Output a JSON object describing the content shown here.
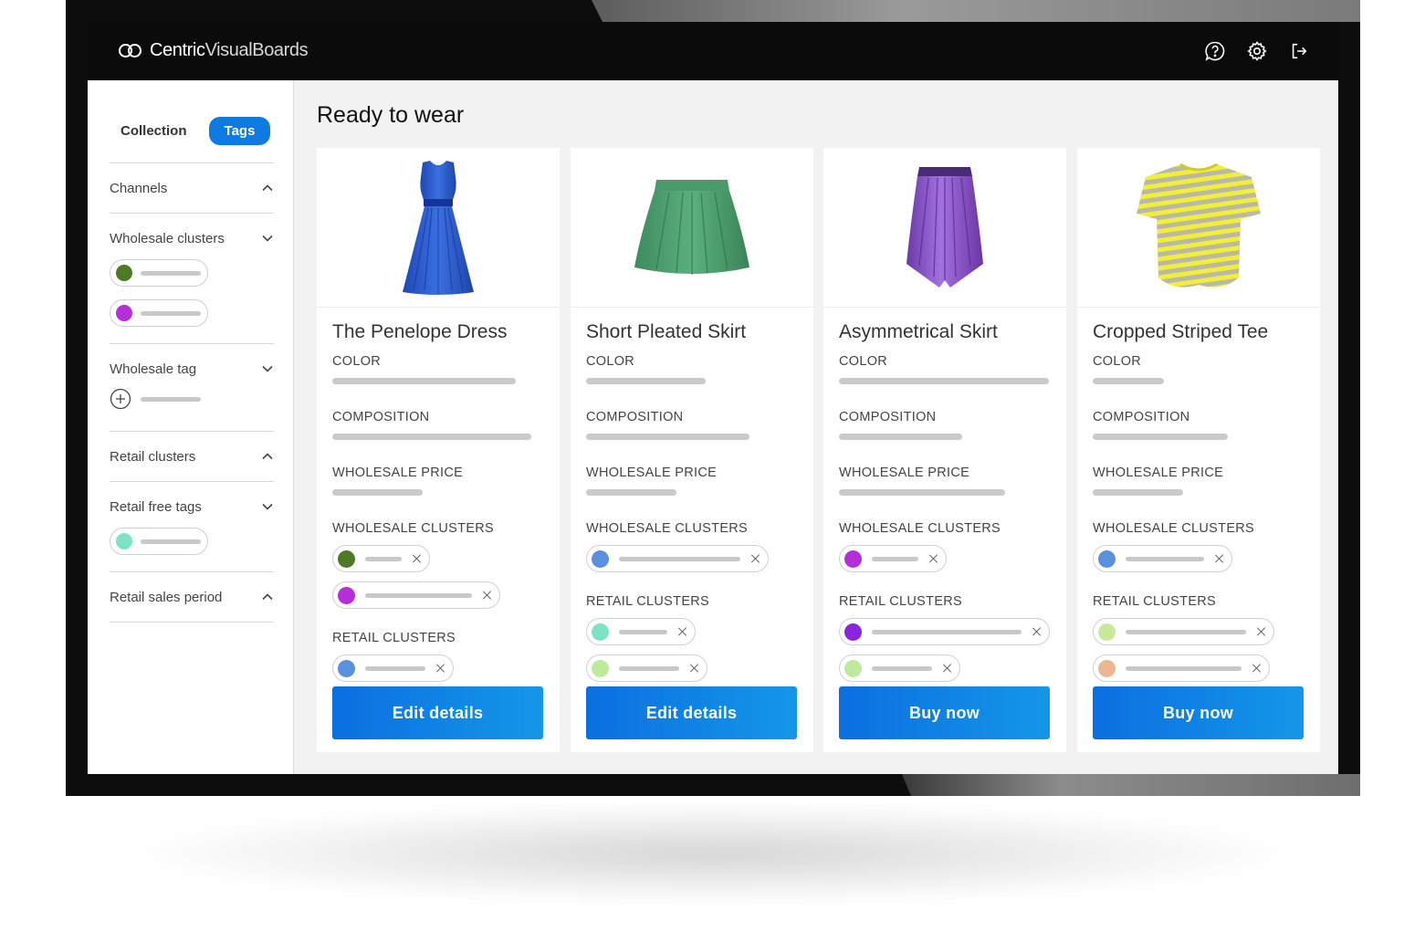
{
  "brand": {
    "name_part1": "Centric",
    "name_part2": "VisualBoards"
  },
  "topbar": {
    "icons": [
      "help-icon",
      "settings-icon",
      "logout-icon"
    ]
  },
  "sidebar": {
    "toggle": {
      "collection": "Collection",
      "tags": "Tags",
      "active": "Tags"
    },
    "sections": [
      {
        "label": "Channels",
        "chevron": "up"
      },
      {
        "label": "Wholesale clusters",
        "chevron": "down",
        "chip_colors": [
          "#4e7a26",
          "#b42fd9"
        ]
      },
      {
        "label": "Wholesale tag",
        "chevron": "down",
        "add": true
      },
      {
        "label": "Retail clusters",
        "chevron": "up"
      },
      {
        "label": "Retail free tags",
        "chevron": "down",
        "chip_colors": [
          "#7ee3c6"
        ]
      },
      {
        "label": "Retail sales period",
        "chevron": "up"
      }
    ]
  },
  "main": {
    "title": "Ready to wear",
    "field_labels": {
      "color": "COLOR",
      "composition": "COMPOSITION",
      "wholesale_price": "WHOLESALE PRICE",
      "wholesale_clusters": "WHOLESALE CLUSTERS",
      "retail_clusters": "RETAIL CLUSTERS"
    },
    "cards": [
      {
        "name": "The Penelope Dress",
        "product": "dress",
        "wholesale_clusters": [
          "#4e7a26",
          "#b42fd9"
        ],
        "retail_clusters": [
          "#5b8fe0"
        ],
        "cta": "Edit details"
      },
      {
        "name": "Short Pleated Skirt",
        "product": "green-skirt",
        "wholesale_clusters": [
          "#5b8fe0"
        ],
        "retail_clusters": [
          "#7ee3c6",
          "#bdeb9a"
        ],
        "cta": "Edit details"
      },
      {
        "name": "Asymmetrical Skirt",
        "product": "purple-skirt",
        "wholesale_clusters": [
          "#b42fd9"
        ],
        "retail_clusters": [
          "#8a25dd",
          "#bdeb9a"
        ],
        "cta": "Buy now"
      },
      {
        "name": "Cropped Striped Tee",
        "product": "striped-tee",
        "wholesale_clusters": [
          "#5b8fe0"
        ],
        "retail_clusters": [
          "#c5eb9a",
          "#e9b892"
        ],
        "cta": "Buy now"
      }
    ]
  }
}
